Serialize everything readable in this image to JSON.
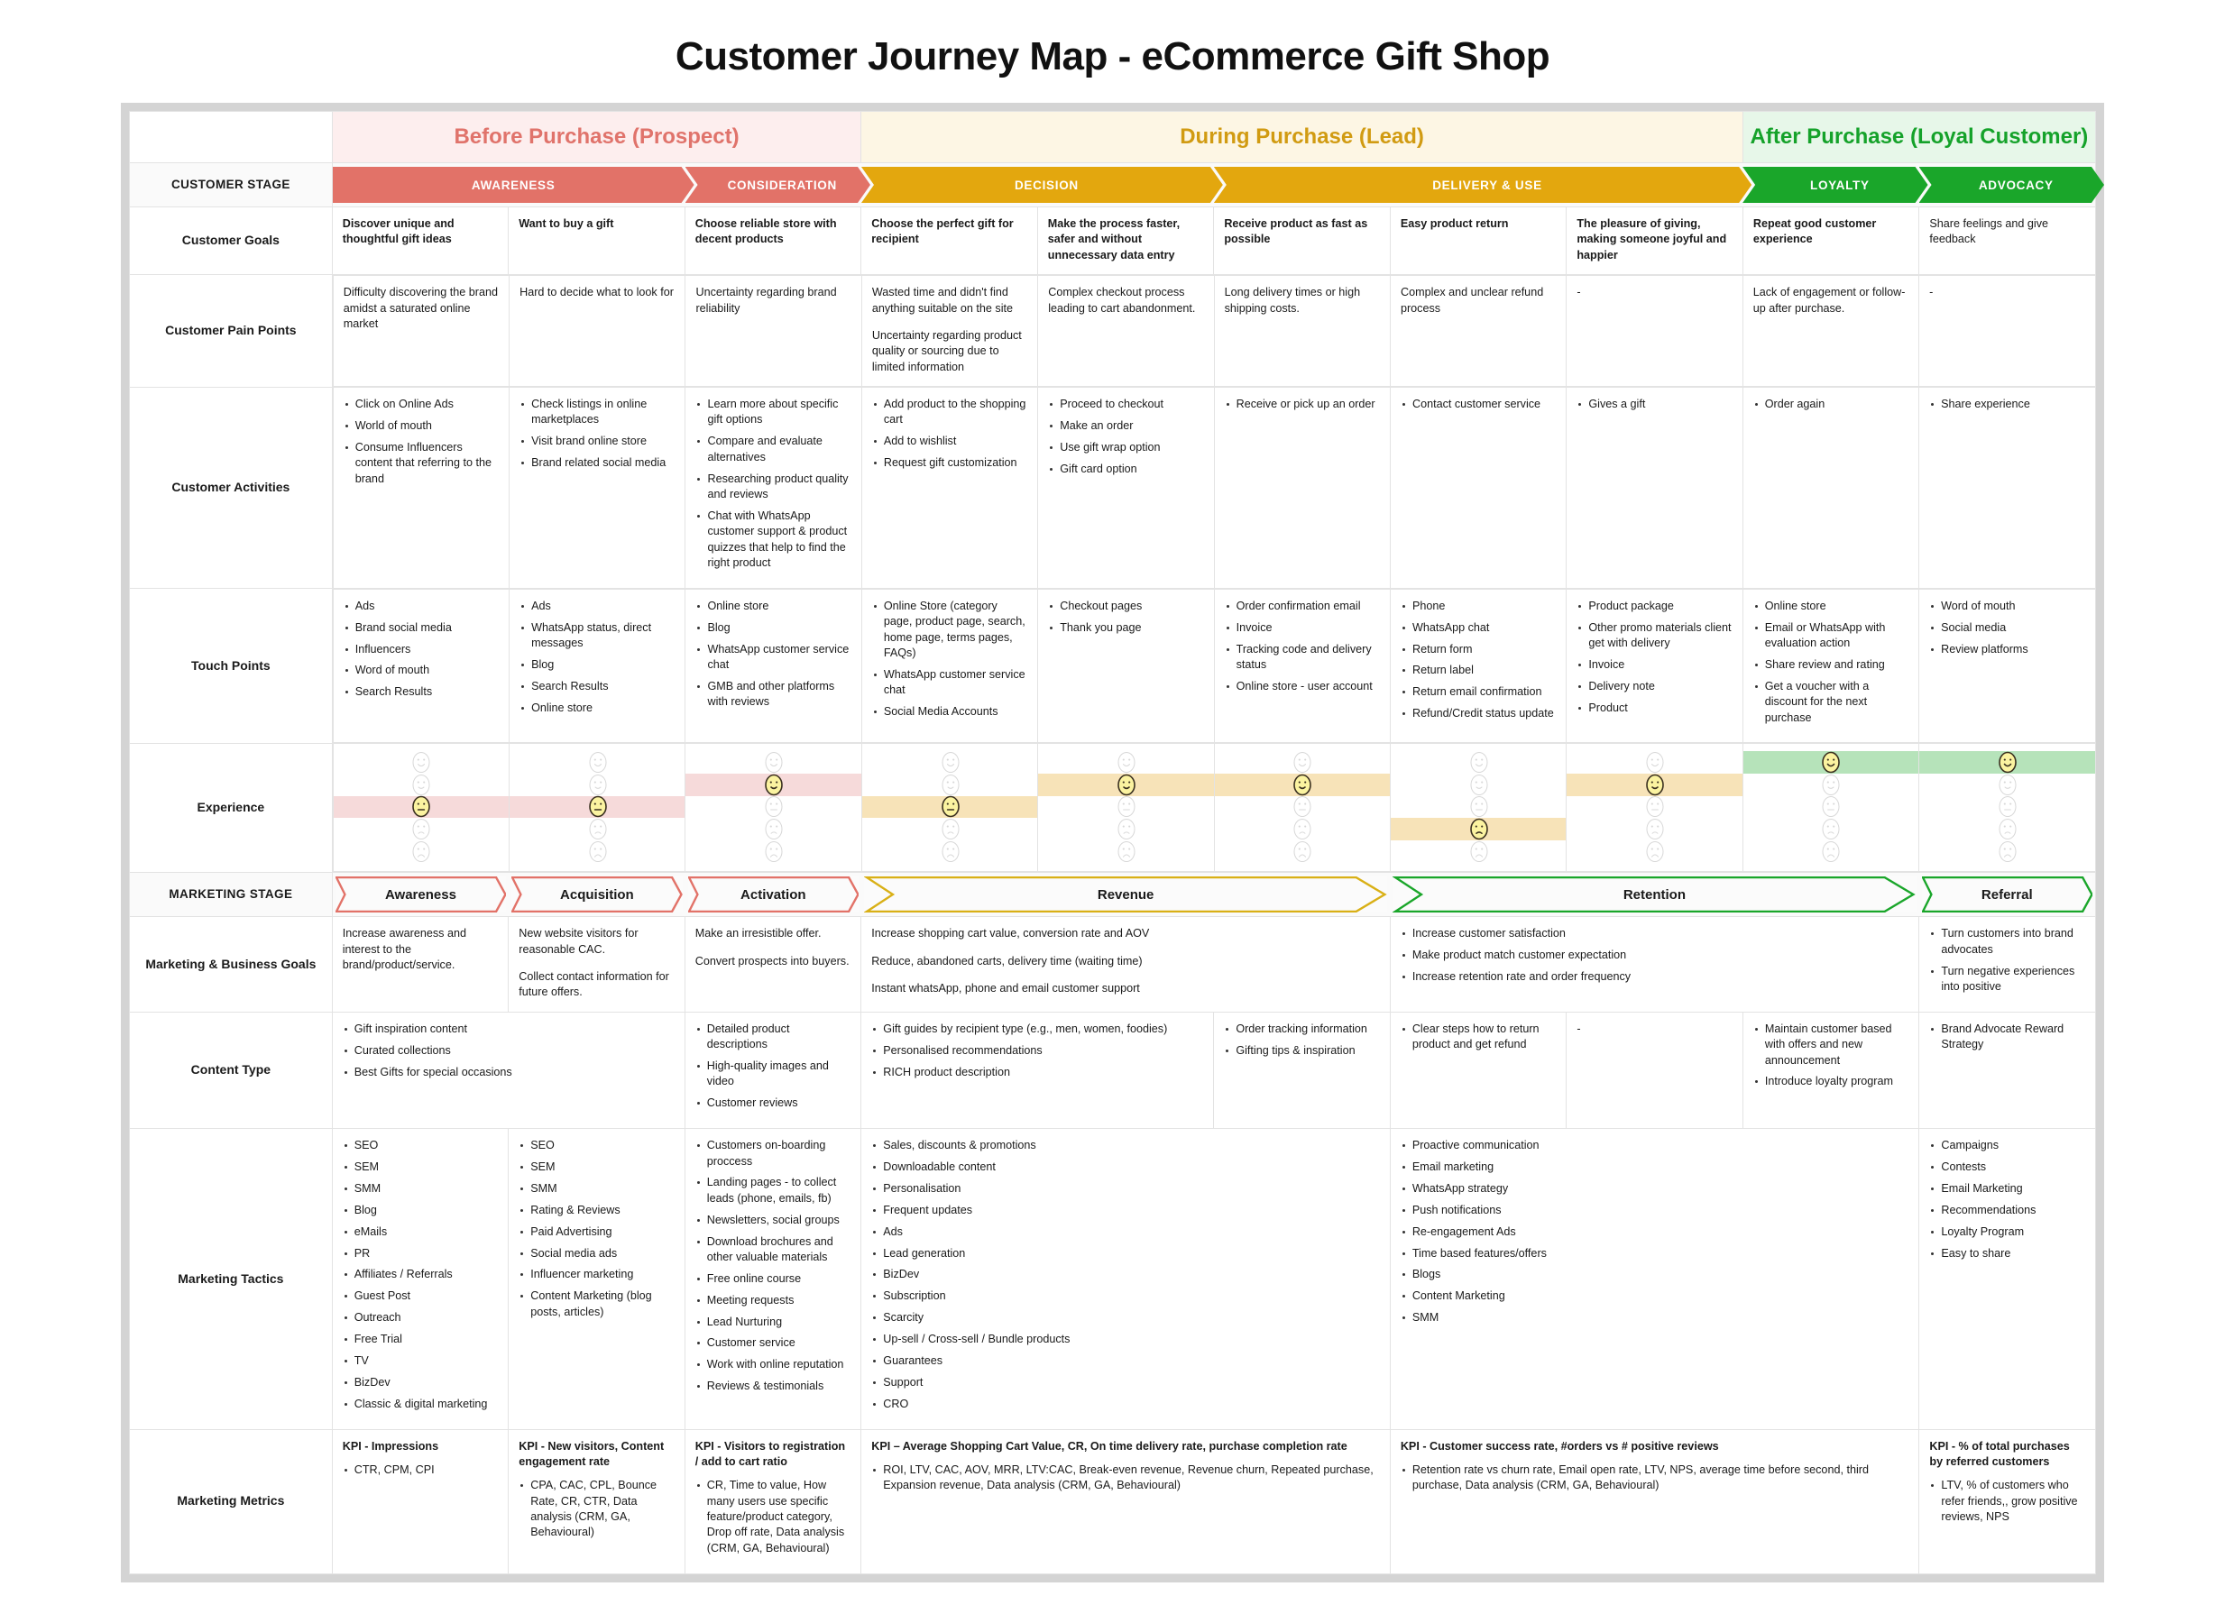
{
  "title": "Customer Journey Map - eCommerce Gift Shop",
  "colors": {
    "before": "#e0736b",
    "during": "#d19b12",
    "after": "#15a22a",
    "stage_red": "#e27268",
    "stage_amber": "#e3a70e",
    "stage_green": "#1aa62a",
    "hl_red": "#f6dada",
    "hl_amber": "#f7e3b8",
    "hl_green": "#b6e3ba",
    "face_yellow": "#fbf3a0"
  },
  "phases": [
    {
      "label": "Before Purchase (Prospect)",
      "span": 3
    },
    {
      "label": "During Purchase (Lead)",
      "span": 5
    },
    {
      "label": "After Purchase (Loyal Customer)",
      "span": 2
    }
  ],
  "row_labels": {
    "customer_stage": "CUSTOMER STAGE",
    "customer_goals": "Customer Goals",
    "customer_pain_points": "Customer Pain Points",
    "customer_activities": "Customer Activities",
    "touch_points": "Touch Points",
    "experience": "Experience",
    "marketing_stage": "MARKETING STAGE",
    "marketing_business_goals": "Marketing & Business Goals",
    "content_type": "Content Type",
    "marketing_tactics": "Marketing Tactics",
    "marketing_metrics": "Marketing Metrics"
  },
  "customer_stages": [
    {
      "label": "AWARENESS",
      "span": 2,
      "color": "red"
    },
    {
      "label": "CONSIDERATION",
      "span": 1,
      "color": "red"
    },
    {
      "label": "DECISION",
      "span": 2,
      "color": "amber"
    },
    {
      "label": "DELIVERY & USE",
      "span": 3,
      "color": "amber"
    },
    {
      "label": "LOYALTY",
      "span": 1,
      "color": "green"
    },
    {
      "label": "ADVOCACY",
      "span": 1,
      "color": "green"
    }
  ],
  "marketing_stages": [
    {
      "label": "Awareness",
      "span": 1,
      "color": "#e27268"
    },
    {
      "label": "Acquisition",
      "span": 1,
      "color": "#e27268"
    },
    {
      "label": "Activation",
      "span": 1,
      "color": "#e27268"
    },
    {
      "label": "Revenue",
      "span": 3,
      "color": "#d9b016"
    },
    {
      "label": "Retention",
      "span": 3,
      "color": "#1aa62a"
    },
    {
      "label": "Referral",
      "span": 1,
      "color": "#1aa62a"
    }
  ],
  "customer_goals": [
    "Discover unique and thoughtful gift ideas",
    "Want to buy a gift",
    "Choose reliable store with decent products",
    "Choose the perfect gift for recipient",
    "Make the process faster, safer and without unnecessary data entry",
    "Receive product as fast as possible",
    "Easy product return",
    "The pleasure of giving, making someone joyful and happier",
    "Repeat good customer experience",
    "Share feelings and give feedback"
  ],
  "customer_pain_points": [
    [
      "Difficulty discovering the brand amidst a saturated online market"
    ],
    [
      "Hard to decide what to look for"
    ],
    [
      "Uncertainty regarding brand reliability"
    ],
    [
      "Wasted time and didn't find anything suitable on the site",
      "Uncertainty regarding product quality or sourcing due to limited information"
    ],
    [
      "Complex checkout process leading to cart abandonment."
    ],
    [
      "Long delivery times or high shipping costs."
    ],
    [
      "Complex and unclear refund process"
    ],
    [
      "-"
    ],
    [
      "Lack of engagement or follow-up after purchase."
    ],
    [
      "-"
    ]
  ],
  "customer_activities": [
    [
      "Click on Online Ads",
      "World of mouth",
      "Consume Influencers content that referring to the brand"
    ],
    [
      "Check listings in online marketplaces",
      "Visit brand online store",
      "Brand related social media"
    ],
    [
      "Learn more about specific gift options",
      "Compare and evaluate alternatives",
      "Researching product quality and reviews",
      "Chat with WhatsApp customer support & product quizzes that help to find the right product"
    ],
    [
      "Add product to the shopping cart",
      "Add to wishlist",
      "Request gift customization"
    ],
    [
      "Proceed to checkout",
      "Make an order",
      "Use gift wrap option",
      "Gift card option"
    ],
    [
      "Receive or pick up an order"
    ],
    [
      "Contact customer service"
    ],
    [
      "Gives a gift"
    ],
    [
      "Order again"
    ],
    [
      "Share experience"
    ]
  ],
  "touch_points": [
    [
      "Ads",
      "Brand social media",
      "Influencers",
      "Word of mouth",
      "Search Results"
    ],
    [
      "Ads",
      "WhatsApp status, direct messages",
      "Blog",
      "Search Results",
      "Online store"
    ],
    [
      "Online store",
      "Blog",
      "WhatsApp customer service chat",
      "GMB and other platforms with reviews"
    ],
    [
      "Online Store (category page, product page, search, home page, terms pages, FAQs)",
      "WhatsApp customer service chat",
      "Social Media Accounts"
    ],
    [
      "Checkout pages",
      "Thank you page"
    ],
    [
      "Order confirmation email",
      "Invoice",
      "Tracking code and delivery status",
      "Online store - user account"
    ],
    [
      "Phone",
      "WhatsApp chat",
      "Return form",
      "Return label",
      "Return email confirmation",
      "Refund/Credit status update"
    ],
    [
      "Product package",
      "Other promo materials client get with delivery",
      "Invoice",
      "Delivery note",
      "Product"
    ],
    [
      "Online store",
      "Email or WhatsApp with evaluation action",
      "Share review and rating",
      "Get a voucher with a discount for the next purchase"
    ],
    [
      "Word of mouth",
      "Social media",
      "Review platforms"
    ]
  ],
  "experience_levels": [
    "very-happy",
    "happy",
    "neutral",
    "sad",
    "very-sad"
  ],
  "experience": [
    {
      "level": 2,
      "tone": "red"
    },
    {
      "level": 2,
      "tone": "red"
    },
    {
      "level": 1,
      "tone": "red"
    },
    {
      "level": 2,
      "tone": "amber"
    },
    {
      "level": 1,
      "tone": "amber"
    },
    {
      "level": 1,
      "tone": "amber"
    },
    {
      "level": 3,
      "tone": "amber"
    },
    {
      "level": 1,
      "tone": "amber"
    },
    {
      "level": 0,
      "tone": "green"
    },
    {
      "level": 0,
      "tone": "green"
    }
  ],
  "marketing_business_goals": [
    [
      "Increase awareness and interest to the brand/product/service."
    ],
    [
      "New website visitors for reasonable CAC.",
      "Collect contact information for future offers."
    ],
    [
      "Make an irresistible offer.",
      "Convert prospects into buyers."
    ],
    [
      "Increase shopping cart value, conversion rate and AOV",
      "Reduce, abandoned carts, delivery time (waiting time)",
      "Instant whatsApp, phone and email customer support"
    ],
    [
      "Increase customer satisfaction",
      "Make product match customer expectation",
      "Increase retention rate and order frequency"
    ],
    [
      "Turn customers into brand advocates",
      "Turn negative experiences into positive"
    ]
  ],
  "content_type": [
    [
      "Gift inspiration content",
      "Curated collections",
      "Best Gifts for special occasions"
    ],
    [],
    [
      "Detailed product descriptions",
      "High-quality images and video",
      "Customer reviews"
    ],
    [
      "Gift guides by recipient type (e.g., men, women, foodies)",
      "Personalised recommendations",
      "RICH product description"
    ],
    [
      "Order tracking information",
      "Gifting tips & inspiration"
    ],
    [
      "Clear steps how to return product and get refund"
    ],
    [
      "-"
    ],
    [
      "Maintain customer based with offers and new announcement",
      "Introduce loyalty program"
    ],
    [
      "Brand Advocate Reward Strategy"
    ]
  ],
  "marketing_tactics": [
    [
      "SEO",
      "SEM",
      "SMM",
      "Blog",
      "eMails",
      "PR",
      "Affiliates / Referrals",
      "Guest Post",
      "Outreach",
      "Free Trial",
      "TV",
      "BizDev",
      "Classic & digital marketing"
    ],
    [
      "SEO",
      "SEM",
      "SMM",
      "Rating & Reviews",
      "Paid Advertising",
      "Social media ads",
      "Influencer marketing",
      "Content Marketing (blog posts, articles)"
    ],
    [
      "Customers on-boarding proccess",
      "Landing pages - to collect leads (phone, emails, fb)",
      "Newsletters, social groups",
      "Download brochures and other valuable materials",
      "Free online course",
      "Meeting requests",
      "Lead Nurturing",
      "Customer service",
      "Work with online reputation",
      "Reviews & testimonials"
    ],
    [
      "Sales, discounts & promotions",
      "Downloadable content",
      "Personalisation",
      "Frequent updates",
      "Ads",
      "Lead generation",
      "BizDev",
      "Subscription",
      "Scarcity",
      "Up-sell / Cross-sell / Bundle products",
      "Guarantees",
      "Support",
      "CRO"
    ],
    [
      "Proactive communication",
      "Email marketing",
      "WhatsApp strategy",
      "Push notifications",
      "Re-engagement Ads",
      "Time based features/offers",
      "Blogs",
      "Content Marketing",
      "SMM"
    ],
    [
      "Campaigns",
      "Contests",
      "Email Marketing",
      "Recommendations",
      "Loyalty Program",
      "Easy to share"
    ]
  ],
  "marketing_metrics": [
    {
      "head": "KPI - Impressions",
      "items": [
        "CTR, CPM, CPI"
      ]
    },
    {
      "head": "KPI - New visitors, Content engagement rate",
      "items": [
        "CPA, CAC, CPL, Bounce Rate, CR, CTR, Data analysis (CRM, GA, Behavioural)"
      ]
    },
    {
      "head": "KPI - Visitors to registration / add to cart ratio",
      "items": [
        "CR, Time to value, How many users use specific feature/product category, Drop off rate, Data analysis (CRM, GA, Behavioural)"
      ]
    },
    {
      "head": "KPI – Average Shopping Cart Value, CR, On time delivery rate, purchase completion rate",
      "items": [
        "ROI, LTV, CAC, AOV, MRR, LTV:CAC, Break-even revenue, Revenue churn, Repeated purchase, Expansion revenue, Data analysis (CRM, GA, Behavioural)"
      ]
    },
    {
      "head": "KPI - Customer success rate, #orders vs # positive reviews",
      "items": [
        "Retention rate vs churn rate, Email open rate, LTV, NPS, average time before second, third purchase, Data analysis (CRM, GA, Behavioural)"
      ]
    },
    {
      "head": "KPI - % of total purchases by referred customers",
      "items": [
        "LTV, % of customers who refer friends,, grow positive reviews, NPS"
      ]
    }
  ]
}
